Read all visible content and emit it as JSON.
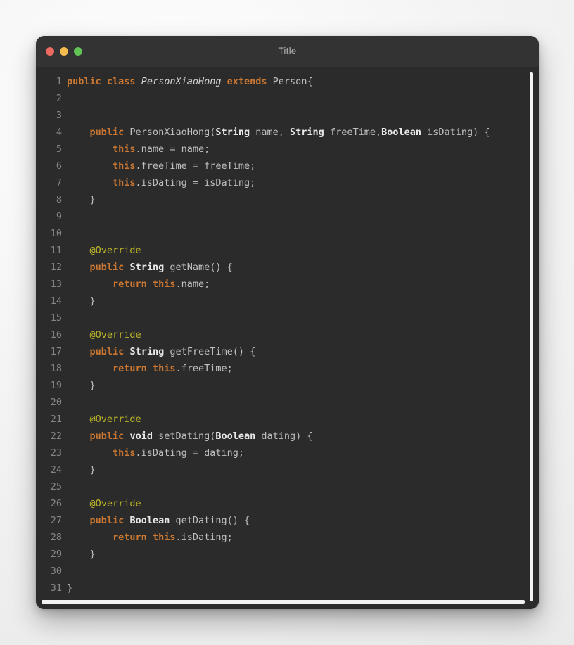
{
  "window": {
    "title": "Title",
    "controls": [
      {
        "name": "close",
        "label": "Close",
        "color": "#ec6a5f"
      },
      {
        "name": "minimize",
        "label": "Minimize",
        "color": "#f5bd4f"
      },
      {
        "name": "zoom",
        "label": "Zoom",
        "color": "#61c454"
      }
    ]
  },
  "theme": {
    "background": "#2b2b2b",
    "titlebar": "#333333",
    "keyword": "#cc7832",
    "type": "#e8e8e8",
    "annotation": "#bbb529",
    "plain": "#bfbfbf",
    "gutter": "#868686",
    "scrollbar": "#f2f2f2"
  },
  "editor": {
    "language": "java",
    "total_lines": 31,
    "first_visible_line": 1,
    "last_visible_line": 31,
    "scrollbars": {
      "vertical_visible": true,
      "horizontal_visible": true
    },
    "lines": [
      {
        "n": 1,
        "tokens": [
          {
            "t": "public",
            "c": "kw"
          },
          {
            "t": " ",
            "c": "pl"
          },
          {
            "t": "class",
            "c": "kw"
          },
          {
            "t": " ",
            "c": "pl"
          },
          {
            "t": "PersonXiaoHong",
            "c": "cls"
          },
          {
            "t": " ",
            "c": "pl"
          },
          {
            "t": "extends",
            "c": "kw"
          },
          {
            "t": " Person{",
            "c": "pl"
          }
        ]
      },
      {
        "n": 2,
        "tokens": []
      },
      {
        "n": 3,
        "tokens": []
      },
      {
        "n": 4,
        "tokens": [
          {
            "t": "    ",
            "c": "pl"
          },
          {
            "t": "public",
            "c": "kw"
          },
          {
            "t": " PersonXiaoHong(",
            "c": "pl"
          },
          {
            "t": "String",
            "c": "type"
          },
          {
            "t": " name, ",
            "c": "pl"
          },
          {
            "t": "String",
            "c": "type"
          },
          {
            "t": " freeTime,",
            "c": "pl"
          },
          {
            "t": "Boolean",
            "c": "type"
          },
          {
            "t": " isDating) {",
            "c": "pl"
          }
        ]
      },
      {
        "n": 5,
        "tokens": [
          {
            "t": "        ",
            "c": "pl"
          },
          {
            "t": "this",
            "c": "kw"
          },
          {
            "t": ".name = name;",
            "c": "pl"
          }
        ]
      },
      {
        "n": 6,
        "tokens": [
          {
            "t": "        ",
            "c": "pl"
          },
          {
            "t": "this",
            "c": "kw"
          },
          {
            "t": ".freeTime = freeTime;",
            "c": "pl"
          }
        ]
      },
      {
        "n": 7,
        "tokens": [
          {
            "t": "        ",
            "c": "pl"
          },
          {
            "t": "this",
            "c": "kw"
          },
          {
            "t": ".isDating = isDating;",
            "c": "pl"
          }
        ]
      },
      {
        "n": 8,
        "tokens": [
          {
            "t": "    }",
            "c": "pl"
          }
        ]
      },
      {
        "n": 9,
        "tokens": []
      },
      {
        "n": 10,
        "tokens": []
      },
      {
        "n": 11,
        "tokens": [
          {
            "t": "    ",
            "c": "pl"
          },
          {
            "t": "@Override",
            "c": "anno"
          }
        ]
      },
      {
        "n": 12,
        "tokens": [
          {
            "t": "    ",
            "c": "pl"
          },
          {
            "t": "public",
            "c": "kw"
          },
          {
            "t": " ",
            "c": "pl"
          },
          {
            "t": "String",
            "c": "type"
          },
          {
            "t": " getName() {",
            "c": "pl"
          }
        ]
      },
      {
        "n": 13,
        "tokens": [
          {
            "t": "        ",
            "c": "pl"
          },
          {
            "t": "return",
            "c": "kw"
          },
          {
            "t": " ",
            "c": "pl"
          },
          {
            "t": "this",
            "c": "kw"
          },
          {
            "t": ".name;",
            "c": "pl"
          }
        ]
      },
      {
        "n": 14,
        "tokens": [
          {
            "t": "    }",
            "c": "pl"
          }
        ]
      },
      {
        "n": 15,
        "tokens": []
      },
      {
        "n": 16,
        "tokens": [
          {
            "t": "    ",
            "c": "pl"
          },
          {
            "t": "@Override",
            "c": "anno"
          }
        ]
      },
      {
        "n": 17,
        "tokens": [
          {
            "t": "    ",
            "c": "pl"
          },
          {
            "t": "public",
            "c": "kw"
          },
          {
            "t": " ",
            "c": "pl"
          },
          {
            "t": "String",
            "c": "type"
          },
          {
            "t": " getFreeTime() {",
            "c": "pl"
          }
        ]
      },
      {
        "n": 18,
        "tokens": [
          {
            "t": "        ",
            "c": "pl"
          },
          {
            "t": "return",
            "c": "kw"
          },
          {
            "t": " ",
            "c": "pl"
          },
          {
            "t": "this",
            "c": "kw"
          },
          {
            "t": ".freeTime;",
            "c": "pl"
          }
        ]
      },
      {
        "n": 19,
        "tokens": [
          {
            "t": "    }",
            "c": "pl"
          }
        ]
      },
      {
        "n": 20,
        "tokens": []
      },
      {
        "n": 21,
        "tokens": [
          {
            "t": "    ",
            "c": "pl"
          },
          {
            "t": "@Override",
            "c": "anno"
          }
        ]
      },
      {
        "n": 22,
        "tokens": [
          {
            "t": "    ",
            "c": "pl"
          },
          {
            "t": "public",
            "c": "kw"
          },
          {
            "t": " ",
            "c": "pl"
          },
          {
            "t": "void",
            "c": "type"
          },
          {
            "t": " setDating(",
            "c": "pl"
          },
          {
            "t": "Boolean",
            "c": "type"
          },
          {
            "t": " dating) {",
            "c": "pl"
          }
        ]
      },
      {
        "n": 23,
        "tokens": [
          {
            "t": "        ",
            "c": "pl"
          },
          {
            "t": "this",
            "c": "kw"
          },
          {
            "t": ".isDating = dating;",
            "c": "pl"
          }
        ]
      },
      {
        "n": 24,
        "tokens": [
          {
            "t": "    }",
            "c": "pl"
          }
        ]
      },
      {
        "n": 25,
        "tokens": []
      },
      {
        "n": 26,
        "tokens": [
          {
            "t": "    ",
            "c": "pl"
          },
          {
            "t": "@Override",
            "c": "anno"
          }
        ]
      },
      {
        "n": 27,
        "tokens": [
          {
            "t": "    ",
            "c": "pl"
          },
          {
            "t": "public",
            "c": "kw"
          },
          {
            "t": " ",
            "c": "pl"
          },
          {
            "t": "Boolean",
            "c": "type"
          },
          {
            "t": " getDating() {",
            "c": "pl"
          }
        ]
      },
      {
        "n": 28,
        "tokens": [
          {
            "t": "        ",
            "c": "pl"
          },
          {
            "t": "return",
            "c": "kw"
          },
          {
            "t": " ",
            "c": "pl"
          },
          {
            "t": "this",
            "c": "kw"
          },
          {
            "t": ".isDating;",
            "c": "pl"
          }
        ]
      },
      {
        "n": 29,
        "tokens": [
          {
            "t": "    }",
            "c": "pl"
          }
        ]
      },
      {
        "n": 30,
        "tokens": []
      },
      {
        "n": 31,
        "tokens": [
          {
            "t": "}",
            "c": "pl"
          }
        ]
      }
    ]
  }
}
